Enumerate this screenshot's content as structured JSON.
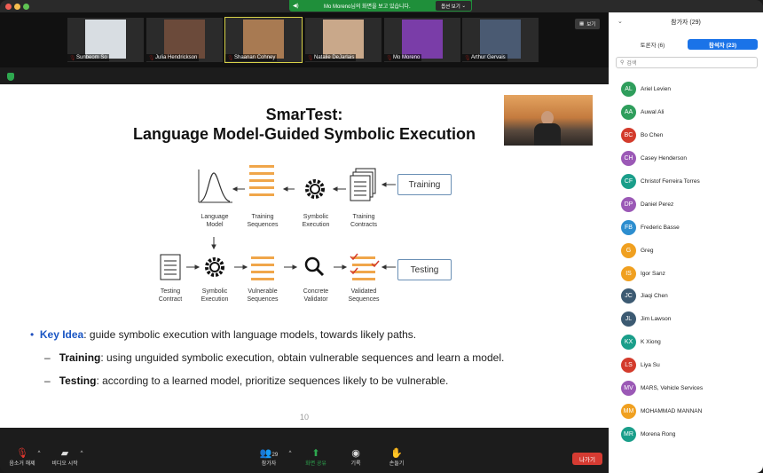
{
  "share_banner": {
    "text": "Mo Moreno님의 화면을 보고 있습니다.",
    "options_label": "옵션 보기"
  },
  "view_button": "보기",
  "videos": [
    {
      "name": "Sunbeom So",
      "active": false
    },
    {
      "name": "Julia Hendrickson",
      "active": false
    },
    {
      "name": "Shaanan Cohney",
      "active": true
    },
    {
      "name": "Natalie DeJarlais",
      "active": false
    },
    {
      "name": "Mo Moreno",
      "active": false
    },
    {
      "name": "Arthur Gervais",
      "active": false
    }
  ],
  "slide": {
    "title_line1": "SmarTest:",
    "title_line2": "Language Model-Guided Symbolic Execution",
    "training_row": [
      "Language\nModel",
      "Training\nSequences",
      "Symbolic\nExecution",
      "Training\nContracts"
    ],
    "testing_row": [
      "Testing\nContract",
      "Symbolic\nExecution",
      "Vulnerable\nSequences",
      "Concrete\nValidator",
      "Validated\nSequences"
    ],
    "tag_training": "Training",
    "tag_testing": "Testing",
    "bullet1_key": "Key Idea",
    "bullet1_rest": ": guide symbolic execution with language models, towards likely paths.",
    "bullet2_key": "Training",
    "bullet2_rest": ": using unguided symbolic execution, obtain vulnerable sequences and learn a model.",
    "bullet3_key": "Testing",
    "bullet3_rest": ": according to a learned model, prioritize sequences likely to be vulnerable.",
    "page_number": "10"
  },
  "toolbar": {
    "unmute": "음소거 해제",
    "start_video": "비디오 시작",
    "participants": "참가자",
    "participants_count": "29",
    "share_screen": "화면 공유",
    "record": "기록",
    "raise_hand": "손들기",
    "leave": "나가기"
  },
  "panel": {
    "header": "참가자 (29)",
    "tab_panelists": "토론자 (6)",
    "tab_attendees": "참석자 (23)",
    "search_placeholder": "검색",
    "participants": [
      {
        "initials": "AL",
        "name": "Ariel Levien",
        "color": "#2f9e5c"
      },
      {
        "initials": "AA",
        "name": "Auwal Ali",
        "color": "#2f9e5c"
      },
      {
        "initials": "BC",
        "name": "Bo Chen",
        "color": "#d33b2c"
      },
      {
        "initials": "CH",
        "name": "Casey Henderson",
        "color": "#9b59b6"
      },
      {
        "initials": "CF",
        "name": "Christof Ferreira Torres",
        "color": "#1a9e8a"
      },
      {
        "initials": "DP",
        "name": "Daniel Perez",
        "color": "#9b59b6"
      },
      {
        "initials": "FB",
        "name": "Frederic Basse",
        "color": "#2d8ecf"
      },
      {
        "initials": "G",
        "name": "Greg",
        "color": "#f0a020"
      },
      {
        "initials": "IS",
        "name": "Igor Sanz",
        "color": "#f0a020"
      },
      {
        "initials": "JC",
        "name": "Jiaqi Chen",
        "color": "#3c5a72"
      },
      {
        "initials": "JL",
        "name": "Jim Lawson",
        "color": "#3c5a72"
      },
      {
        "initials": "KX",
        "name": "K Xiong",
        "color": "#1a9e8a"
      },
      {
        "initials": "LS",
        "name": "Liya Su",
        "color": "#d33b2c"
      },
      {
        "initials": "MV",
        "name": "MARS, Vehicle Services",
        "color": "#9b59b6"
      },
      {
        "initials": "MM",
        "name": "MOHAMMAD MANNAN",
        "color": "#f0a020"
      },
      {
        "initials": "MR",
        "name": "Morena Rong",
        "color": "#1a9e8a"
      }
    ]
  }
}
